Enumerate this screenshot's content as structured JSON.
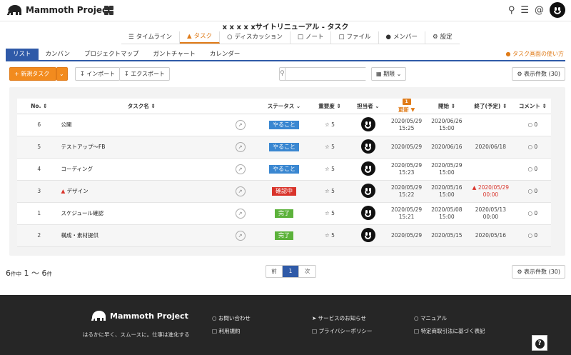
{
  "brand": {
    "name": "Mammoth Project",
    "tagline": "はるかに早く、スムースに。仕事は進化する"
  },
  "project_title": "x x x x xサイトリニューアル - タスク",
  "main_tabs": [
    "タイムライン",
    "タスク",
    "ディスカッション",
    "ノート",
    "ファイル",
    "メンバー",
    "設定"
  ],
  "sub_tabs": [
    "リスト",
    "カンバン",
    "プロジェクトマップ",
    "ガントチャート",
    "カレンダー"
  ],
  "howto": "タスク画面の使い方",
  "toolbar": {
    "new_task": "新規タスク",
    "import": "インポート",
    "export": "エクスポート",
    "deadline": "期限",
    "display_count": "表示件数 (30)",
    "search_placeholder": ""
  },
  "table": {
    "headers": {
      "no": "No.",
      "name": "タスク名",
      "status": "ステータス",
      "priority": "重要度",
      "assignee": "担当者",
      "updated": "更新",
      "start": "開始",
      "end": "終了(予定)",
      "comments": "コメント"
    },
    "update_count": "1",
    "rows": [
      {
        "no": "6",
        "name": "公開",
        "status": "やること",
        "priority": "5",
        "updated_date": "2020/05/29",
        "updated_time": "15:25",
        "start_date": "2020/06/26",
        "start_time": "15:00",
        "end_date": "",
        "end_time": "",
        "comments": "0"
      },
      {
        "no": "5",
        "name": "テストアップ〜FB",
        "status": "やること",
        "priority": "5",
        "updated_date": "2020/05/29",
        "updated_time": "",
        "start_date": "2020/06/16",
        "start_time": "",
        "end_date": "2020/06/18",
        "end_time": "",
        "comments": "0"
      },
      {
        "no": "4",
        "name": "コーディング",
        "status": "やること",
        "priority": "5",
        "updated_date": "2020/05/29",
        "updated_time": "15:23",
        "start_date": "2020/05/29",
        "start_time": "15:00",
        "end_date": "",
        "end_time": "",
        "comments": "0"
      },
      {
        "no": "3",
        "name": "デザイン",
        "status": "確認中",
        "priority": "5",
        "updated_date": "2020/05/29",
        "updated_time": "15:22",
        "start_date": "2020/05/16",
        "start_time": "15:00",
        "end_date": "2020/05/29",
        "end_time": "00:00",
        "comments": "0"
      },
      {
        "no": "1",
        "name": "スケジュール確認",
        "status": "完了",
        "priority": "5",
        "updated_date": "2020/05/29",
        "updated_time": "15:21",
        "start_date": "2020/05/08",
        "start_time": "15:00",
        "end_date": "2020/05/13",
        "end_time": "00:00",
        "comments": "0"
      },
      {
        "no": "2",
        "name": "構成・素材提供",
        "status": "完了",
        "priority": "5",
        "updated_date": "2020/05/29",
        "updated_time": "",
        "start_date": "2020/05/15",
        "start_time": "",
        "end_date": "2020/05/16",
        "end_time": "",
        "comments": "0"
      }
    ]
  },
  "pagination": {
    "total": "6",
    "total_unit": "件中",
    "range": "1 ～ 6",
    "range_unit": "件",
    "prev": "前",
    "current": "1",
    "next": "次"
  },
  "footer_links": [
    "お問い合わせ",
    "サービスのお知らせ",
    "マニュアル",
    "利用規約",
    "プライバシーポリシー",
    "特定商取引法に基づく表記"
  ],
  "colors": {
    "accent": "#e07b18",
    "primary": "#2f5aa8",
    "todo": "#3a87d1",
    "review": "#d9342b",
    "done": "#5cb23b"
  }
}
